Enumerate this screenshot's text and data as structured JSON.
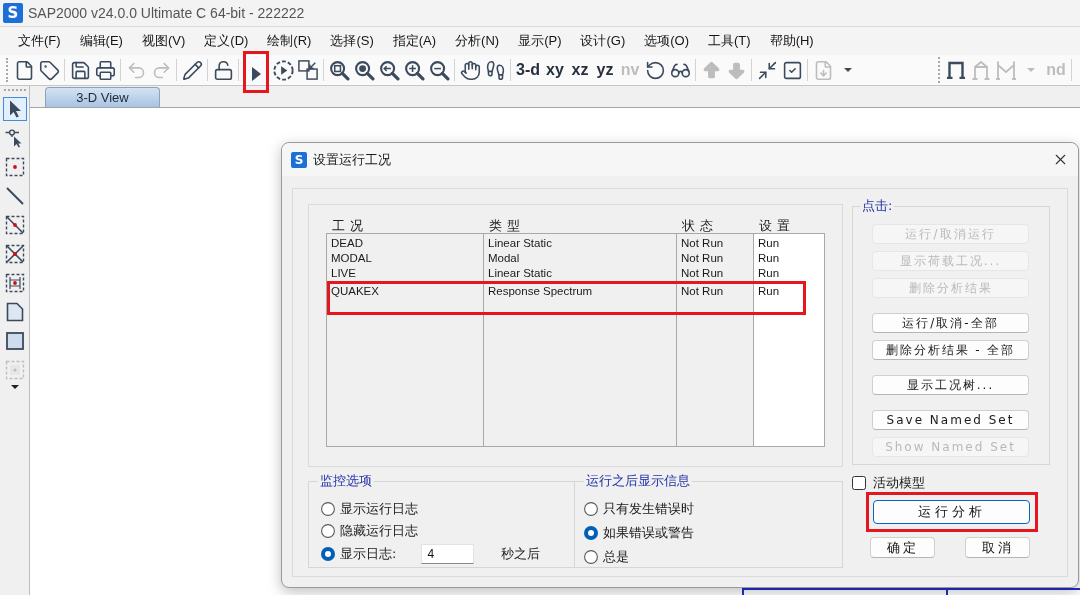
{
  "window": {
    "logo": "S",
    "title": "SAP2000 v24.0.0 Ultimate C 64-bit - 222222"
  },
  "menu": [
    "文件(F)",
    "编辑(E)",
    "视图(V)",
    "定义(D)",
    "绘制(R)",
    "选择(S)",
    "指定(A)",
    "分析(N)",
    "显示(P)",
    "设计(G)",
    "选项(O)",
    "工具(T)",
    "帮助(H)"
  ],
  "toolbar": {
    "groups": [
      [
        {
          "kind": "icon",
          "disabled": false,
          "highlighted": false
        },
        {
          "kind": "icon",
          "disabled": false,
          "highlighted": false
        }
      ],
      [
        {
          "kind": "icon",
          "disabled": false,
          "highlighted": false
        },
        {
          "kind": "icon",
          "disabled": false,
          "highlighted": false
        }
      ],
      [
        {
          "kind": "icon",
          "disabled": true,
          "highlighted": false
        },
        {
          "kind": "icon",
          "disabled": true,
          "highlighted": false
        }
      ],
      [
        {
          "kind": "icon",
          "disabled": false,
          "highlighted": false
        }
      ],
      [
        {
          "kind": "icon",
          "disabled": false,
          "highlighted": false
        }
      ],
      [
        {
          "kind": "icon",
          "disabled": false,
          "highlighted": true
        },
        {
          "kind": "icon",
          "disabled": false,
          "highlighted": false
        },
        {
          "kind": "icon",
          "disabled": false,
          "highlighted": false
        }
      ],
      [
        {
          "kind": "icon",
          "disabled": false,
          "highlighted": false
        },
        {
          "kind": "icon",
          "disabled": false,
          "highlighted": false
        },
        {
          "kind": "icon",
          "disabled": false,
          "highlighted": false
        },
        {
          "kind": "icon",
          "disabled": false,
          "highlighted": false
        },
        {
          "kind": "icon",
          "disabled": false,
          "highlighted": false
        }
      ],
      [
        {
          "kind": "icon",
          "disabled": false,
          "highlighted": false
        },
        {
          "kind": "icon",
          "disabled": false,
          "highlighted": false
        }
      ],
      [
        {
          "kind": "text",
          "label": "3-d",
          "disabled": false,
          "highlighted": false
        },
        {
          "kind": "text",
          "label": "xy",
          "disabled": false,
          "highlighted": false
        },
        {
          "kind": "text",
          "label": "xz",
          "disabled": false,
          "highlighted": false
        },
        {
          "kind": "text",
          "label": "yz",
          "disabled": false,
          "highlighted": false
        },
        {
          "kind": "text",
          "label": "nv",
          "disabled": true,
          "highlighted": false
        },
        {
          "kind": "icon",
          "disabled": false,
          "highlighted": false
        },
        {
          "kind": "icon",
          "disabled": false,
          "highlighted": false
        }
      ],
      [
        {
          "kind": "icon",
          "disabled": true,
          "highlighted": false
        },
        {
          "kind": "icon",
          "disabled": true,
          "highlighted": false
        }
      ],
      [
        {
          "kind": "icon",
          "disabled": false,
          "highlighted": false
        },
        {
          "kind": "icon",
          "disabled": false,
          "highlighted": false
        }
      ],
      [
        {
          "kind": "icon",
          "disabled": true,
          "highlighted": false
        },
        {
          "kind": "icon",
          "disabled": false,
          "highlighted": false
        }
      ]
    ]
  },
  "toolbar_2": {
    "groups": [
      [
        {
          "kind": "icon",
          "disabled": false,
          "highlighted": false
        },
        {
          "kind": "icon",
          "disabled": true,
          "highlighted": false
        },
        {
          "kind": "icon",
          "disabled": true,
          "highlighted": false
        },
        {
          "kind": "icon",
          "disabled": true,
          "highlighted": false
        },
        {
          "kind": "text",
          "label": "nd",
          "disabled": true,
          "highlighted": false
        }
      ]
    ]
  },
  "left_toolbar": [
    {
      "selected": true,
      "disabled": false
    },
    {
      "selected": false,
      "disabled": false
    },
    {
      "selected": false,
      "disabled": false
    },
    {
      "selected": false,
      "disabled": false
    },
    {
      "selected": false,
      "disabled": false
    },
    {
      "selected": false,
      "disabled": false
    },
    {
      "selected": false,
      "disabled": false
    },
    {
      "selected": false,
      "disabled": false
    },
    {
      "selected": false,
      "disabled": false
    },
    {
      "selected": false,
      "disabled": true
    }
  ],
  "tabs": [
    {
      "label": "3-D View",
      "selected": true
    }
  ],
  "dialog": {
    "logo": "S",
    "title": "设置运行工况",
    "table": {
      "columns": [
        "工况",
        "类型",
        "状态",
        "设置"
      ],
      "rows": [
        {
          "cells": [
            "DEAD",
            "Linear Static",
            "Not Run",
            "Run"
          ],
          "highlighted": false
        },
        {
          "cells": [
            "MODAL",
            "Modal",
            "Not Run",
            "Run"
          ],
          "highlighted": false
        },
        {
          "cells": [
            "LIVE",
            "Linear Static",
            "Not Run",
            "Run"
          ],
          "highlighted": false
        },
        {
          "cells": [
            "QUAKEX",
            "Response Spectrum",
            "Not Run",
            "Run"
          ],
          "highlighted": true
        }
      ]
    },
    "monitor": {
      "title": "监控选项",
      "options": [
        {
          "label": "显示运行日志",
          "selected": false
        },
        {
          "label": "隐藏运行日志",
          "selected": false
        },
        {
          "label": "显示日志:",
          "selected": true
        }
      ],
      "delay_value": "4",
      "delay_unit": "秒之后"
    },
    "after_run": {
      "title": "运行之后显示信息",
      "options": [
        {
          "label": "只有发生错误时",
          "selected": false
        },
        {
          "label": "如果错误或警告",
          "selected": true
        },
        {
          "label": "总是",
          "selected": false
        }
      ]
    },
    "actions": {
      "title": "点击:",
      "groups": [
        [
          {
            "label": "运行/取消运行",
            "disabled": true
          },
          {
            "label": "显示荷载工况...",
            "disabled": true
          },
          {
            "label": "删除分析结果",
            "disabled": true
          }
        ],
        [
          {
            "label": "运行/取消-全部",
            "disabled": false
          },
          {
            "label": "删除分析结果 - 全部",
            "disabled": false
          }
        ],
        [
          {
            "label": "显示工况树...",
            "disabled": false
          }
        ],
        [
          {
            "label": "Save Named Set",
            "disabled": false
          },
          {
            "label": "Show Named Set",
            "disabled": true
          }
        ]
      ]
    },
    "active_model": {
      "label": "活动模型",
      "checked": false
    },
    "run_button": {
      "label": "运行分析",
      "highlighted": true
    },
    "ok_button": "确定",
    "cancel_button": "取消"
  }
}
